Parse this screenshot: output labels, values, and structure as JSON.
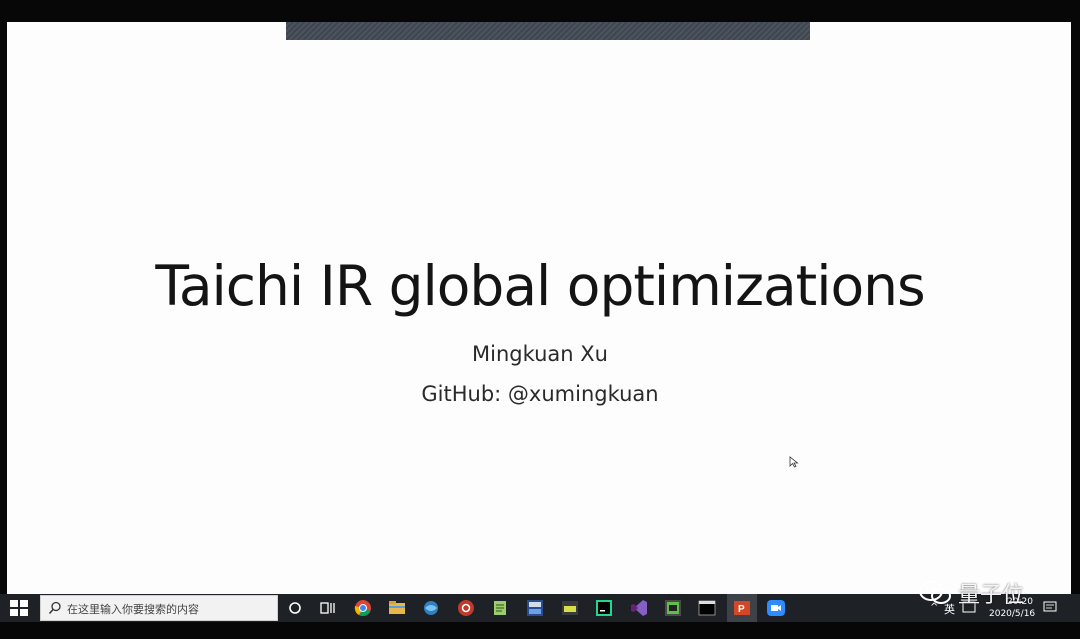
{
  "slide": {
    "title": "Taichi IR global optimizations",
    "author": "Mingkuan Xu",
    "github": "GitHub: @xumingkuan"
  },
  "taskbar": {
    "search_placeholder": "在这里输入你要搜索的内容",
    "apps": [
      "task-view",
      "chrome",
      "file-explorer",
      "network",
      "settings",
      "notepad",
      "devc",
      "terminal-app",
      "pycharm",
      "visual-studio",
      "sublime",
      "cmd",
      "powerpoint",
      "zoom"
    ],
    "tray": {
      "lang": "英",
      "time": "20:20",
      "date": "2020/5/16"
    }
  },
  "watermark": {
    "text": "量子位"
  }
}
